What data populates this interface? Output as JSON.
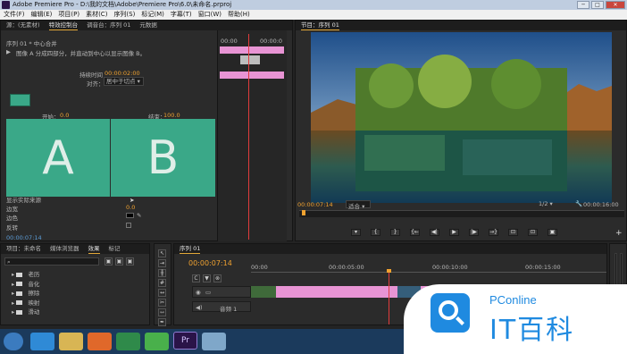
{
  "window": {
    "title": "Adobe Premiere Pro - D:\\我的文档\\Adobe\\Premiere Pro\\6.0\\未命名.prproj",
    "min": "─",
    "max": "□",
    "close": "✕"
  },
  "menu": [
    "文件(F)",
    "编辑(E)",
    "项目(P)",
    "素材(C)",
    "序列(S)",
    "标记(M)",
    "字幕(T)",
    "窗口(W)",
    "帮助(H)"
  ],
  "effect_panel": {
    "tabs": [
      "源：(无素材)",
      "特效控制台",
      "调音台：序列 01",
      "元数据"
    ],
    "sequence_label": "序列 01 * 中心合并",
    "description": "图像 A 分成四部分，并直动到中心以显示图像 B。",
    "duration_label": "持续时间",
    "duration_value": "00:00:02:00",
    "align_label": "对齐：",
    "align_value": "居中于切点",
    "start_label": "开始：",
    "start_value": "0.0",
    "end_label": "结束：",
    "end_value": "100.0",
    "tile_a": "A",
    "tile_b": "B",
    "show_actual": "显示实际来源",
    "border_width_label": "边宽",
    "border_width_value": "0.0",
    "border_color_label": "边色",
    "reverse_label": "反转",
    "timecode": "00:00:07:14",
    "mini_timecode_start": "00:00",
    "mini_timecode_end": "00:00:0"
  },
  "program_monitor": {
    "tab": "节目：序列 01",
    "timecode": "00:00:07:14",
    "fit": "适合",
    "page": "1/2",
    "duration": "00:00:16:00",
    "buttons": [
      "▾",
      "{",
      "}",
      "{←",
      "◀|",
      "▶",
      "|▶",
      "→}",
      "⊡",
      "⊡",
      "▣"
    ],
    "add": "+"
  },
  "project_panel": {
    "tabs": [
      "项目：未命名",
      "媒体浏览器",
      "效果",
      "标记"
    ],
    "search_placeholder": "",
    "folders": [
      "预设",
      "音频特效",
      "音频过渡",
      "视频特效",
      "视频切换"
    ],
    "visible_folder_labels": [
      "老历",
      "音化",
      "擦除",
      "映射",
      "滑动"
    ]
  },
  "timeline": {
    "tab": "序列 01",
    "timecode": "00:00:07:14",
    "ruler": [
      "00:00",
      "00:00:05:00",
      "00:00:10:00",
      "00:00:15:00"
    ],
    "audio_label": "音频 1",
    "video_track": "视频 1"
  },
  "watermark": {
    "brand": "PConline",
    "title": "IT百科"
  },
  "taskbar": {
    "apps": [
      "start",
      "ie",
      "explorer",
      "firefox",
      "media",
      "360",
      "premiere",
      "window"
    ],
    "premiere_label": "Pr"
  },
  "colors": {
    "accent": "#f0a230",
    "tile": "#3aa888",
    "clip": "#e894d4",
    "playhead": "#e23c3c"
  }
}
